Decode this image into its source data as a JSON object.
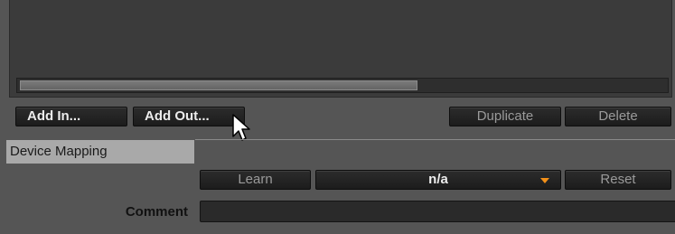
{
  "mapping_list": {
    "scrollbar": "horizontal"
  },
  "buttons": {
    "add_in": "Add In...",
    "add_out": "Add Out...",
    "duplicate": "Duplicate",
    "delete": "Delete"
  },
  "device_mapping": {
    "header": "Device Mapping",
    "learn": "Learn",
    "dropdown_value": "n/a",
    "dropdown_arrow_color": "#f29019",
    "reset": "Reset",
    "comment_label": "Comment",
    "comment_value": ""
  },
  "icons": {
    "cursor": "mouse-pointer-icon",
    "dropdown": "chevron-down-icon"
  }
}
